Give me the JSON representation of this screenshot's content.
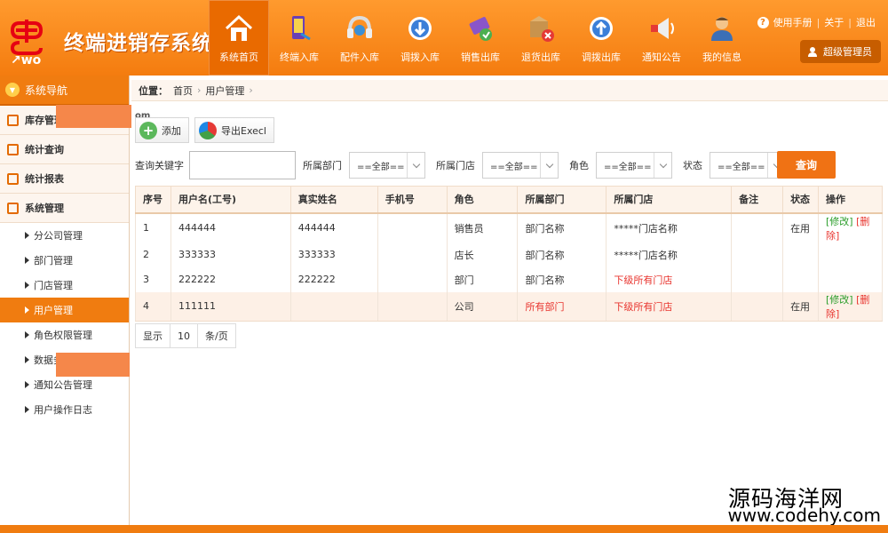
{
  "app": {
    "title": "终端进销存系统"
  },
  "nav": [
    {
      "label": "系统首页",
      "icon": "home-icon",
      "active": true
    },
    {
      "label": "终端入库",
      "icon": "phone-in-icon"
    },
    {
      "label": "配件入库",
      "icon": "headset-icon"
    },
    {
      "label": "调拨入库",
      "icon": "transfer-in-icon"
    },
    {
      "label": "销售出库",
      "icon": "sales-out-icon"
    },
    {
      "label": "退货出库",
      "icon": "return-out-icon"
    },
    {
      "label": "调拨出库",
      "icon": "transfer-out-icon"
    },
    {
      "label": "通知公告",
      "icon": "megaphone-icon"
    },
    {
      "label": "我的信息",
      "icon": "user-info-icon"
    }
  ],
  "top_links": {
    "help": "使用手册",
    "about": "关于",
    "logout": "退出"
  },
  "user": {
    "name": "超级管理员"
  },
  "sidebar": {
    "header": "系统导航",
    "groups": [
      "库存管理",
      "统计查询",
      "统计报表",
      "系统管理"
    ],
    "items": [
      "分公司管理",
      "部门管理",
      "门店管理",
      "用户管理",
      "角色权限管理",
      "数据务",
      "通知公告管理",
      "用户操作日志"
    ]
  },
  "breadcrumb": {
    "label": "位置：",
    "home": "首页",
    "current": "用户管理"
  },
  "fragment": "om",
  "toolbar": {
    "add": "添加",
    "export": "导出Execl"
  },
  "filters": {
    "keyword_label": "查询关键字",
    "keyword_value": "",
    "dept_label": "所属部门",
    "dept_value": "==全部==",
    "store_label": "所属门店",
    "store_value": "==全部==",
    "role_label": "角色",
    "role_value": "==全部==",
    "status_label": "状态",
    "status_value": "==全部==",
    "query_button": "查询"
  },
  "table": {
    "headers": [
      "序号",
      "用户名(工号)",
      "真实姓名",
      "手机号",
      "角色",
      "所属部门",
      "所属门店",
      "备注",
      "状态",
      "操作"
    ],
    "rows": [
      {
        "no": "1",
        "user": "444444",
        "name": "444444",
        "phone": "",
        "role": "销售员",
        "dept": "部门名称",
        "store": "*****门店名称",
        "note": "",
        "status": "在用",
        "edit": "[修改]",
        "del": "[删除]"
      },
      {
        "no": "2",
        "user": "333333",
        "name": "333333",
        "phone": "",
        "role": "店长",
        "dept": "部门名称",
        "store": "*****门店名称",
        "note": "",
        "status": "",
        "edit": "",
        "del": ""
      },
      {
        "no": "3",
        "user": "222222",
        "name": "222222",
        "phone": "",
        "role": "部门",
        "dept": "部门名称",
        "store": "下级所有门店",
        "note": "",
        "status": "",
        "edit": "",
        "del": ""
      },
      {
        "no": "4",
        "user": "111111",
        "name": "",
        "phone": "",
        "role": "公司",
        "dept": "所有部门",
        "store": "下级所有门店",
        "note": "",
        "status": "在用",
        "edit": "[修改]",
        "del": "[删除]"
      }
    ]
  },
  "pager": {
    "show": "显示",
    "size": "10",
    "unit": "条/页"
  },
  "watermark": {
    "line1": "源码海洋网",
    "line2": "www.codehy.com"
  },
  "colors": {
    "brand": "#f07c10",
    "brand_dark": "#d76500",
    "link_green": "#2a9d2a",
    "link_red": "#e8342e"
  }
}
